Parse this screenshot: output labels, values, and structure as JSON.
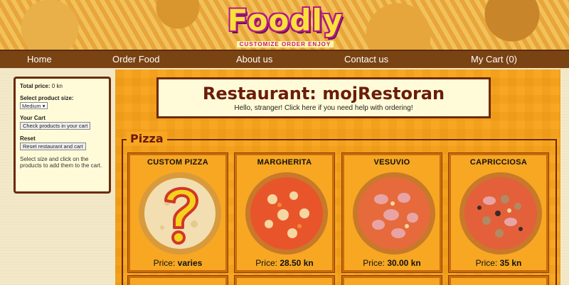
{
  "brand": {
    "name": "Foodly",
    "tagline": "CUSTOMIZE ORDER ENJOY"
  },
  "nav": {
    "home": "Home",
    "order": "Order Food",
    "about": "About us",
    "contact": "Contact us",
    "cart": "My Cart (0)"
  },
  "sidebar": {
    "total_label": "Total price:",
    "total_value": "0 kn",
    "size_label": "Select product size:",
    "size_value": "Medium",
    "cart_label": "Your Cart",
    "cart_button": "Check products in your cart",
    "reset_label": "Reset",
    "reset_button": "Reset restaurant and cart",
    "help_text": "Select size and click on the products to add them to the cart."
  },
  "header": {
    "title": "Restaurant: mojRestoran",
    "subtitle": "Hello, stranger! Click here if you need help with ordering!"
  },
  "category": {
    "name": "Pizza"
  },
  "products": [
    {
      "name": "CUSTOM PIZZA",
      "price_label": "Price:",
      "price": "varies"
    },
    {
      "name": "MARGHERITA",
      "price_label": "Price:",
      "price": "28.50 kn"
    },
    {
      "name": "VESUVIO",
      "price_label": "Price:",
      "price": "30.00 kn"
    },
    {
      "name": "CAPRICCIOSA",
      "price_label": "Price:",
      "price": "35 kn"
    }
  ],
  "colors": {
    "accent": "#7a4313",
    "title": "#6b1c0a",
    "panel": "#fffbd8",
    "content_bg": "#f7a722"
  }
}
